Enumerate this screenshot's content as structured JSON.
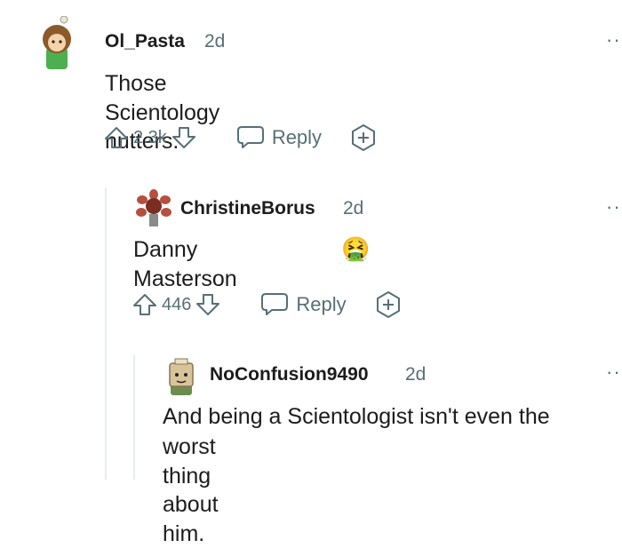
{
  "comments": [
    {
      "username": "Ol_Pasta",
      "time": "2d",
      "text": "Those Scientology nutters.",
      "score": "2.3k",
      "reply_label": "Reply"
    },
    {
      "username": "ChristineBorus",
      "time": "2d",
      "text": "Danny Masterson",
      "emoji": "🤮",
      "score": "446",
      "reply_label": "Reply"
    },
    {
      "username": "NoConfusion9490",
      "time": "2d",
      "text_line1": "And being a Scientologist isn't even the",
      "text_line2": "worst thing about him."
    }
  ],
  "more_glyph": "··",
  "colors": {
    "meta": "#576f76",
    "text": "#1c1c1c",
    "thread_line": "#e5ebee"
  }
}
